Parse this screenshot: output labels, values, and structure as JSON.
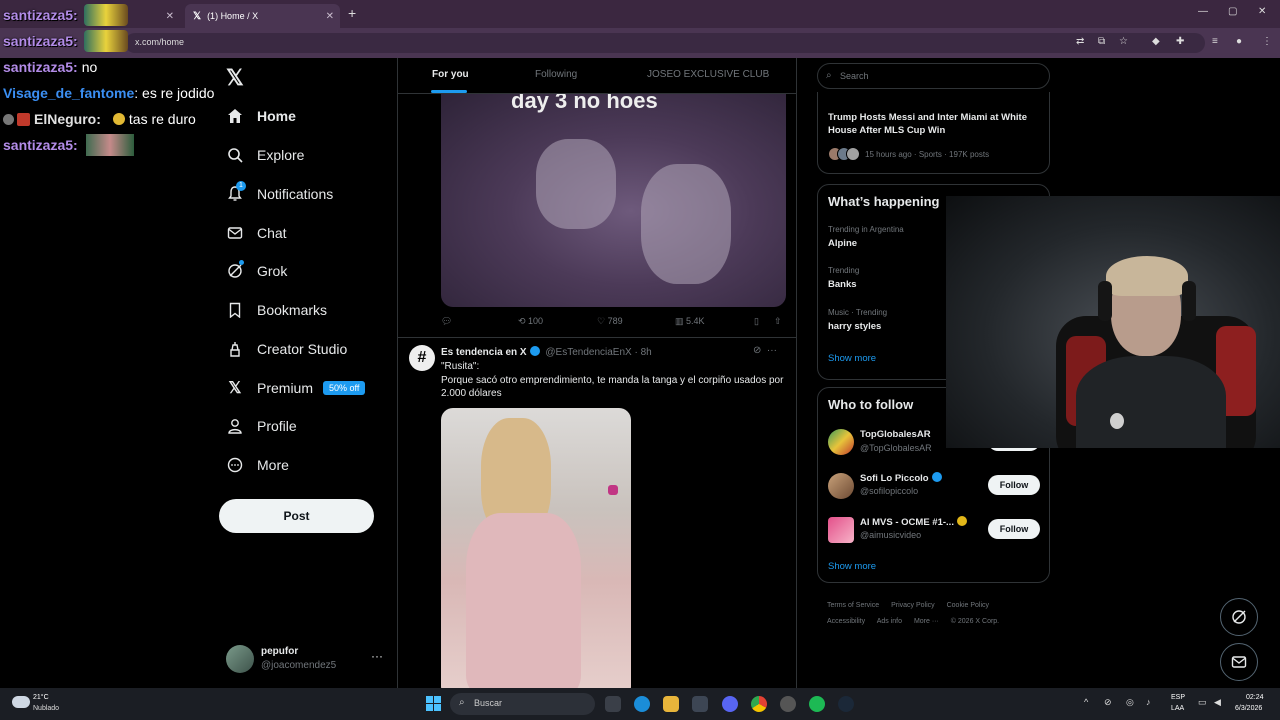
{
  "browser": {
    "tabs": [
      {
        "title": "(1) Home / X"
      }
    ],
    "url": "x.com/home",
    "new_tab": "+",
    "window_controls": [
      "—",
      "▢",
      "✕"
    ]
  },
  "chat": {
    "lines": [
      {
        "user": "santizaza5:",
        "user_color": "#b38ce8",
        "msg": "",
        "emote": true
      },
      {
        "user": "santizaza5:",
        "user_color": "#b38ce8",
        "msg": "",
        "emote": true
      },
      {
        "user": "santizaza5:",
        "user_color": "#b38ce8",
        "msg": "no",
        "emote": false
      },
      {
        "user": "Visage_de_fantome",
        "user_color": "#3b8ff3",
        "msg": ": es re jodido",
        "emote": false
      },
      {
        "user": "ElNeguro:",
        "user_color": "#e0e0e0",
        "msg": "tas re duro",
        "emote": false
      },
      {
        "user": "santizaza5:",
        "user_color": "#b38ce8",
        "msg": "",
        "emote": true
      }
    ]
  },
  "nav": {
    "items": [
      {
        "label": "Home",
        "icon": "home-icon"
      },
      {
        "label": "Explore",
        "icon": "search-icon"
      },
      {
        "label": "Notifications",
        "icon": "bell-icon",
        "badge": "1"
      },
      {
        "label": "Chat",
        "icon": "mail-icon"
      },
      {
        "label": "Grok",
        "icon": "grok-icon"
      },
      {
        "label": "Bookmarks",
        "icon": "bookmark-icon"
      },
      {
        "label": "Creator Studio",
        "icon": "creator-icon"
      },
      {
        "label": "Premium",
        "icon": "x-icon",
        "badge_text": "50% off"
      },
      {
        "label": "Profile",
        "icon": "profile-icon"
      },
      {
        "label": "More",
        "icon": "more-circle-icon"
      }
    ],
    "post_label": "Post",
    "account": {
      "name": "pepufor",
      "handle": "@joacomendez5"
    }
  },
  "feed": {
    "tabs": [
      "For you",
      "Following",
      "JOSEO EXCLUSIVE CLUB"
    ],
    "tweet1": {
      "media_caption": "day 3 no hoes",
      "replies": "",
      "retweets": "100",
      "likes": "789",
      "views": "5.4K"
    },
    "tweet2": {
      "name": "Es tendencia en X",
      "handle": "@EsTendenciaEnX",
      "time": "· 8h",
      "text_line1": "\"Rusita\":",
      "text_line2": "Porque sacó otro emprendimiento, te manda la tanga y el corpiño usados por 2.000 dólares"
    }
  },
  "right": {
    "search_placeholder": "Search",
    "news": {
      "title": "Trump Hosts Messi and Inter Miami at White House After MLS Cup Win",
      "meta": "15 hours ago · Sports · 197K posts"
    },
    "happening": {
      "title": "What’s happening",
      "trends": [
        {
          "meta": "Trending in Argentina",
          "name": "Alpine"
        },
        {
          "meta": "Trending",
          "name": "Banks"
        },
        {
          "meta": "Music · Trending",
          "name": "harry styles"
        }
      ],
      "show_more": "Show more"
    },
    "who_to_follow": {
      "title": "Who to follow",
      "accounts": [
        {
          "name": "TopGlobalesAR",
          "handle": "@TopGlobalesAR",
          "follow": "Follow"
        },
        {
          "name": "Sofi Lo Piccolo",
          "handle": "@sofilopiccolo",
          "follow": "Follow"
        },
        {
          "name": "AI MVS - OCME #1-...",
          "handle": "@aimusicvideo",
          "follow": "Follow"
        }
      ],
      "show_more": "Show more"
    },
    "footer": [
      "Terms of Service",
      "Privacy Policy",
      "Cookie Policy",
      "Accessibility",
      "Ads info",
      "More ···",
      "© 2026 X Corp."
    ]
  },
  "taskbar": {
    "temp": "21°C",
    "weather": "Nublado",
    "search": "Buscar",
    "lang1": "ESP",
    "lang2": "LAA",
    "time": "02:24",
    "date": "6/3/2026"
  }
}
